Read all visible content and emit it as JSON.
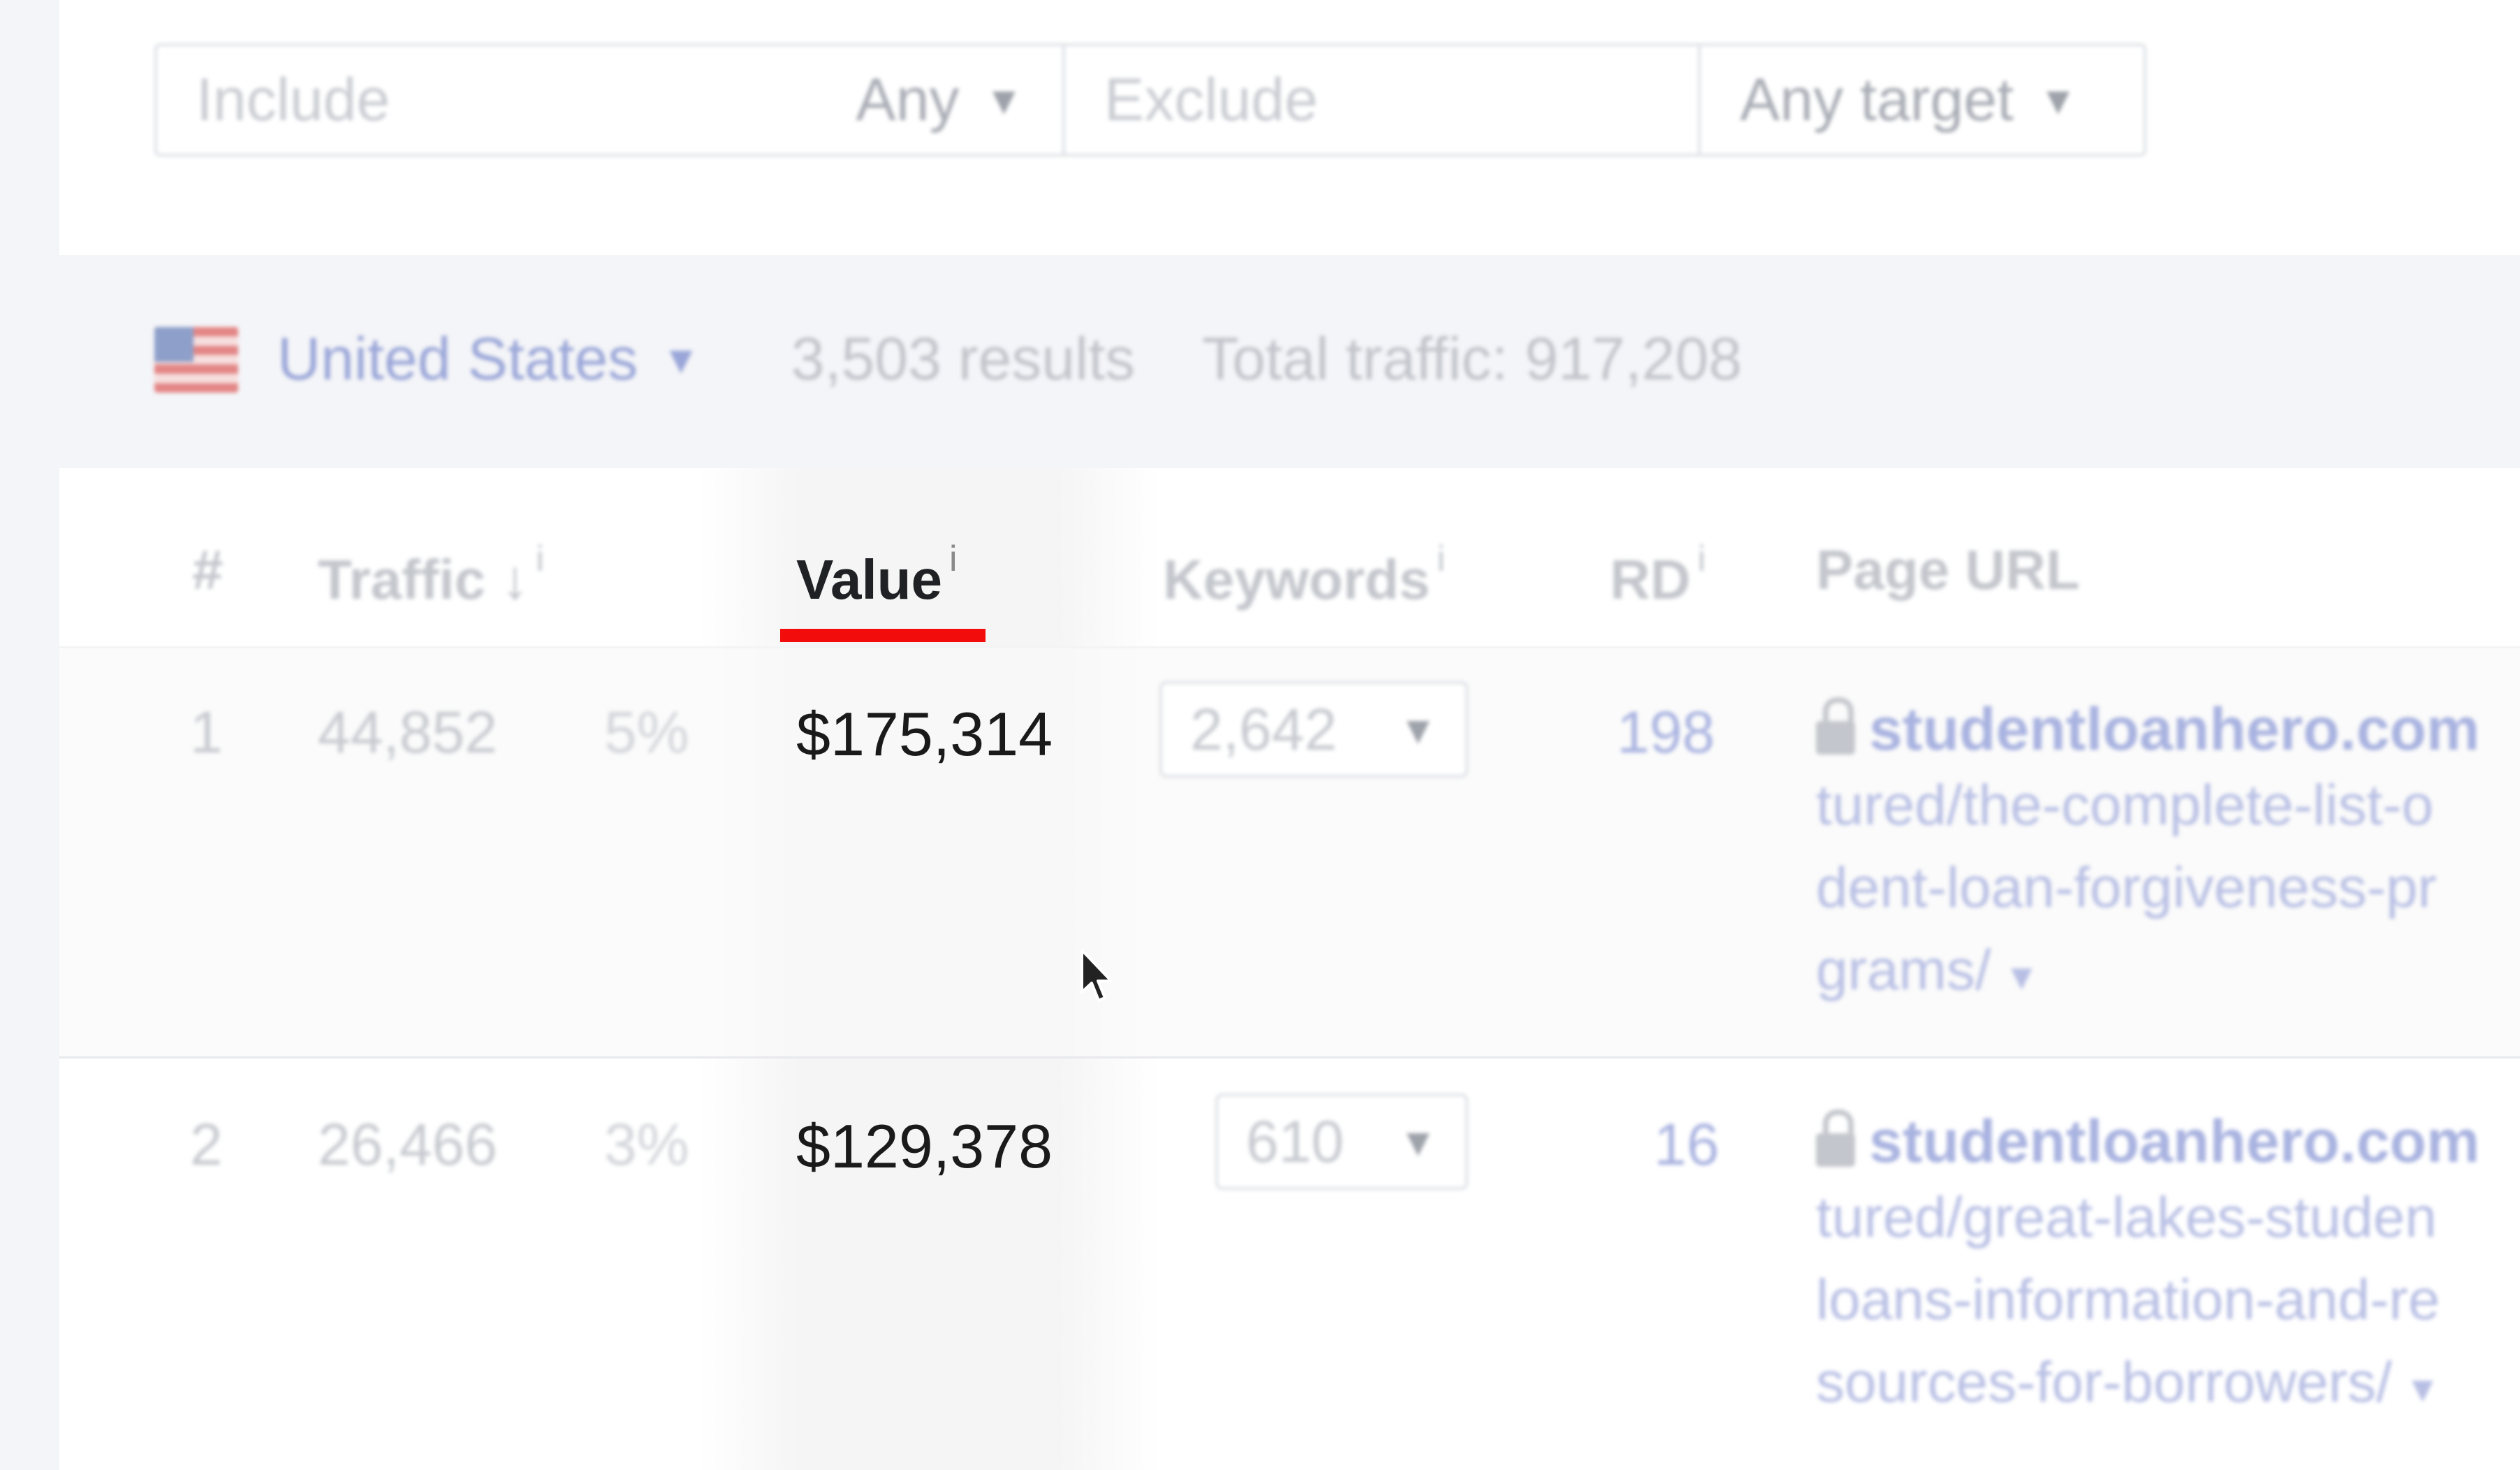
{
  "filters": {
    "include_placeholder": "Include",
    "include_mode": "Any",
    "exclude_placeholder": "Exclude",
    "target": "Any target"
  },
  "summary": {
    "country": "United States",
    "results": "3,503 results",
    "total_traffic": "Total traffic: 917,208"
  },
  "table": {
    "headers": {
      "num": "#",
      "traffic": "Traffic ↓",
      "value": "Value",
      "keywords": "Keywords",
      "rd": "RD",
      "page_url": "Page URL",
      "info": "i"
    },
    "rows": [
      {
        "num": "1",
        "traffic": "44,852",
        "pct": "5%",
        "value": "$175,314",
        "keywords": "2,642",
        "rd": "198",
        "domain": "studentloanhero.com",
        "url_lines": [
          "tured/the-complete-list-o",
          "dent-loan-forgiveness-pr",
          "grams/"
        ]
      },
      {
        "num": "2",
        "traffic": "26,466",
        "pct": "3%",
        "value": "$129,378",
        "keywords": "610",
        "rd": "16",
        "domain": "studentloanhero.com",
        "url_lines": [
          "tured/great-lakes-studen",
          "loans-information-and-re",
          "sources-for-borrowers/"
        ]
      }
    ]
  },
  "colors": {
    "active_underline": "#f20c0c",
    "link": "#a9b3e0",
    "active_text": "#202124"
  }
}
